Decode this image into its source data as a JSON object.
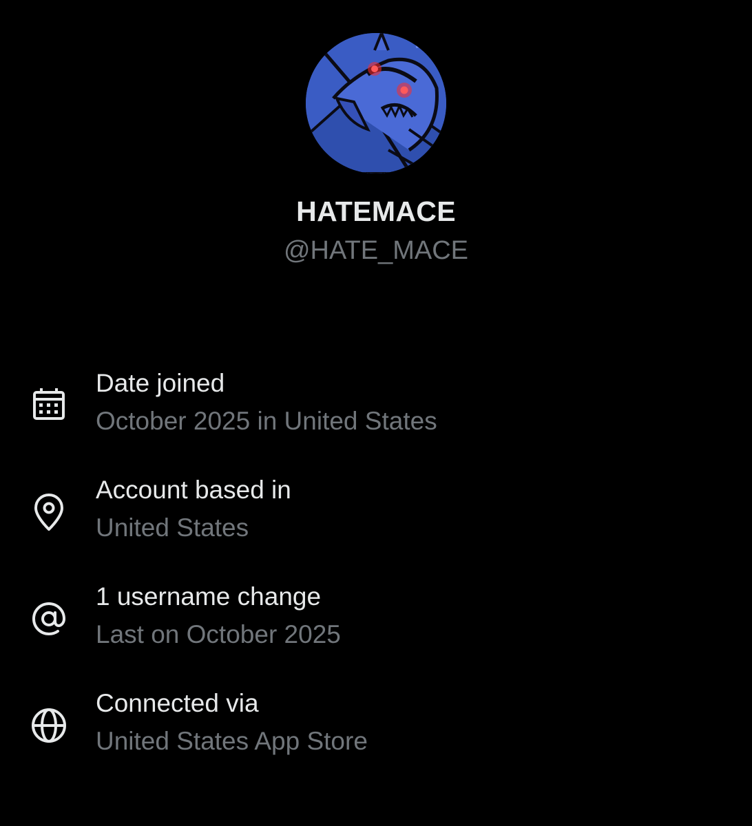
{
  "profile": {
    "display_name": "HATEMACE",
    "handle": "@HATE_MACE"
  },
  "about": {
    "items": [
      {
        "icon": "calendar-icon",
        "title": "Date joined",
        "value": "October 2025 in United States"
      },
      {
        "icon": "location-pin-icon",
        "title": "Account based in",
        "value": "United States"
      },
      {
        "icon": "at-sign-icon",
        "title": "1 username change",
        "value": "Last on October 2025"
      },
      {
        "icon": "globe-icon",
        "title": "Connected via",
        "value": "United States App Store"
      }
    ]
  },
  "colors": {
    "background": "#000000",
    "primary_text": "#e7e9ea",
    "secondary_text": "#71767b",
    "avatar_blue": "#3a5cc4",
    "avatar_eyes": "#ff2a2a"
  }
}
